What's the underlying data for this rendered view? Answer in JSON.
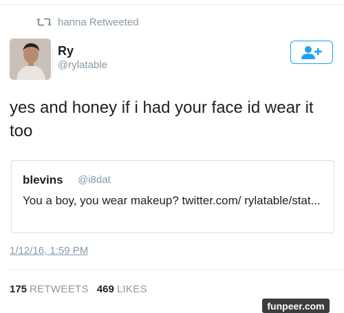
{
  "retweet_context": {
    "text": "hanna Retweeted",
    "icon": "retweet-icon"
  },
  "author": {
    "name": "Ry",
    "handle": "@rylatable",
    "avatar": "avatar-photo"
  },
  "follow_button": {
    "icon": "add-user-icon",
    "color": "#1da1f2"
  },
  "tweet": {
    "text": "yes and honey if i had your face id wear it too"
  },
  "quoted_tweet": {
    "name": "blevins",
    "handle": "@i8dat",
    "text": "You a boy, you wear makeup?  twitter.com/ rylatable/stat..."
  },
  "timestamp": "1/12/16, 1:59 PM",
  "stats": {
    "retweets_count": "175",
    "retweets_label": "RETWEETS",
    "likes_count": "469",
    "likes_label": "LIKES"
  },
  "watermark": "funpeer.com",
  "colors": {
    "accent": "#1da1f2",
    "muted": "#8899a6",
    "text": "#1c2022"
  }
}
